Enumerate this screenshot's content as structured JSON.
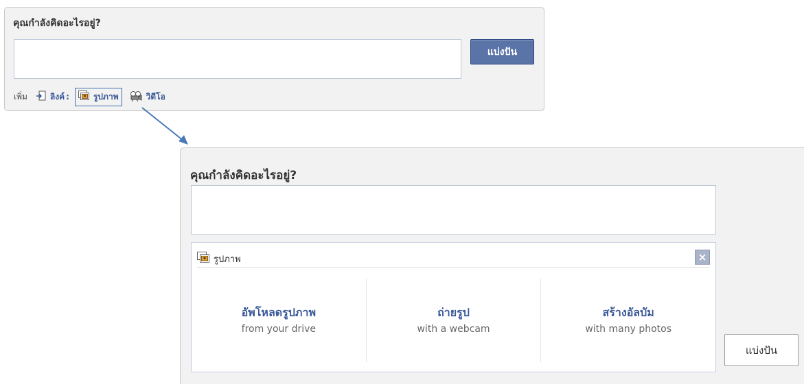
{
  "composer": {
    "prompt": "คุณกำลังคิดอะไรอยู่?",
    "share_label": "แบ่งปัน",
    "attach_label": "เพิ่ม",
    "attachments": [
      {
        "label": "ลิงค์",
        "suffix": ":",
        "icon": "link-icon"
      },
      {
        "label": "รูปภาพ",
        "suffix": "",
        "icon": "photo-icon"
      },
      {
        "label": "วิดีโอ",
        "suffix": "",
        "icon": "video-icon"
      }
    ]
  },
  "expanded": {
    "prompt": "คุณกำลังคิดอะไรอยู่?",
    "photo_panel": {
      "title": "รูปภาพ",
      "icon": "photo-icon",
      "close_icon": "close-icon",
      "options": [
        {
          "main": "อัพโหลดรูปภาพ",
          "sub": "from your drive"
        },
        {
          "main": "ถ่ายรูป",
          "sub": "with a webcam"
        },
        {
          "main": "สร้างอัลบัม",
          "sub": "with many photos"
        }
      ]
    },
    "share_label": "แบ่งปัน"
  },
  "colors": {
    "link_blue": "#3b5998",
    "button_blue": "#5b74a8",
    "highlight_box": "#3b6fb0",
    "panel_bg": "#f2f2f2"
  }
}
